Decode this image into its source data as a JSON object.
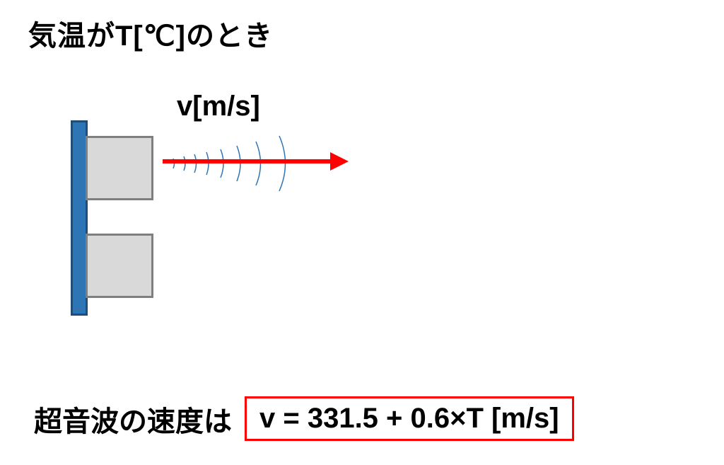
{
  "title": "気温がT[℃]のとき",
  "velocity_label": "v[m/s]",
  "speed_text": "超音波の速度は",
  "formula": "v = 331.5 + 0.6×T [m/s]",
  "colors": {
    "bar_fill": "#2e75b6",
    "bar_border": "#1f4e79",
    "block_fill": "#d9d9d9",
    "block_border": "#7f7f7f",
    "arrow": "#ff0000",
    "wave": "#2e75b6",
    "formula_border": "#ff0000"
  },
  "physics": {
    "base_speed_mps": 331.5,
    "temp_coeff_mps_per_c": 0.6,
    "variable_temp": "T",
    "variable_velocity": "v",
    "unit_temp": "℃",
    "unit_velocity": "m/s"
  }
}
